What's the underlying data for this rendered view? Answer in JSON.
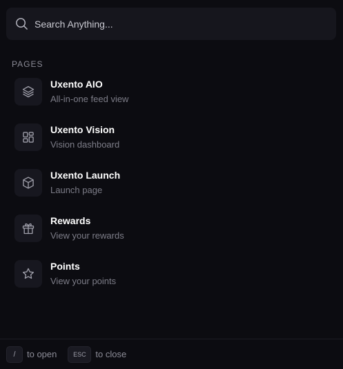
{
  "search": {
    "placeholder": "Search Anything...",
    "value": ""
  },
  "section": {
    "label": "PAGES"
  },
  "items": [
    {
      "title": "Uxento AIO",
      "subtitle": "All-in-one feed view",
      "icon": "layers-icon"
    },
    {
      "title": "Uxento Vision",
      "subtitle": "Vision dashboard",
      "icon": "dashboard-icon"
    },
    {
      "title": "Uxento Launch",
      "subtitle": "Launch page",
      "icon": "cube-icon"
    },
    {
      "title": "Rewards",
      "subtitle": "View your rewards",
      "icon": "gift-icon"
    },
    {
      "title": "Points",
      "subtitle": "View your points",
      "icon": "star-icon"
    }
  ],
  "footer": {
    "open_key": "/",
    "open_hint": "to open",
    "close_key": "ESC",
    "close_hint": "to close"
  },
  "colors": {
    "background": "#0c0c11",
    "surface": "#16161d",
    "tile": "#17171f",
    "text_primary": "#ffffff",
    "text_secondary": "#7d7d88",
    "icon_stroke": "#a0a0ab"
  }
}
